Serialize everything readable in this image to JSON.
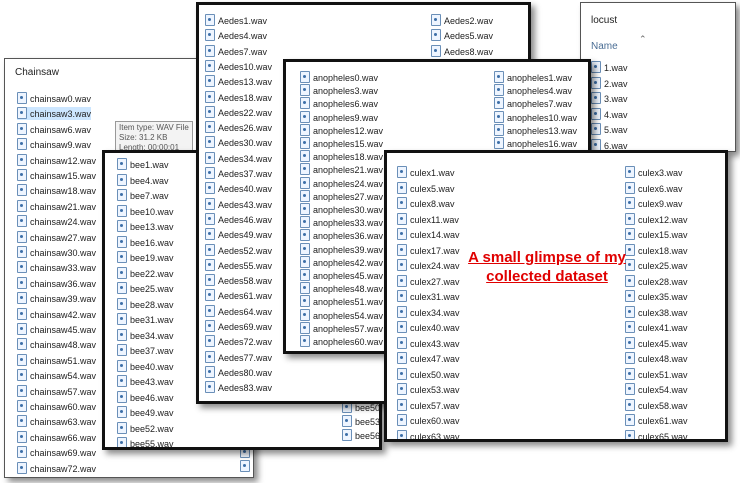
{
  "chainsaw": {
    "title": "Chainsaw",
    "files": [
      "chainsaw0.wav",
      "chainsaw3.wav",
      "chainsaw6.wav",
      "chainsaw9.wav",
      "chainsaw12.wav",
      "chainsaw15.wav",
      "chainsaw18.wav",
      "chainsaw21.wav",
      "chainsaw24.wav",
      "chainsaw27.wav",
      "chainsaw30.wav",
      "chainsaw33.wav",
      "chainsaw36.wav",
      "chainsaw39.wav",
      "chainsaw42.wav",
      "chainsaw45.wav",
      "chainsaw48.wav",
      "chainsaw51.wav",
      "chainsaw54.wav",
      "chainsaw57.wav",
      "chainsaw60.wav",
      "chainsaw63.wav",
      "chainsaw66.wav",
      "chainsaw69.wav",
      "chainsaw72.wav"
    ],
    "files_col2": [
      "chainsaw70.wav",
      "chainsaw73.wav"
    ],
    "tooltip": {
      "type": "Item type: WAV File",
      "size": "Size: 31.2 KB",
      "length": "Length: 00:00:01"
    }
  },
  "bee": {
    "files": [
      "bee1.wav",
      "bee4.wav",
      "bee7.wav",
      "bee10.wav",
      "bee13.wav",
      "bee16.wav",
      "bee19.wav",
      "bee22.wav",
      "bee25.wav",
      "bee28.wav",
      "bee31.wav",
      "bee34.wav",
      "bee37.wav",
      "bee40.wav",
      "bee43.wav",
      "bee46.wav",
      "bee49.wav",
      "bee52.wav",
      "bee55.wav"
    ],
    "files_col2": [
      "bee50.wav",
      "bee53.wav",
      "bee56.wav"
    ]
  },
  "aedes": {
    "col1": [
      "Aedes1.wav",
      "Aedes4.wav",
      "Aedes7.wav",
      "Aedes10.wav",
      "Aedes13.wav",
      "Aedes18.wav",
      "Aedes22.wav",
      "Aedes26.wav",
      "Aedes30.wav",
      "Aedes34.wav",
      "Aedes37.wav",
      "Aedes40.wav",
      "Aedes43.wav",
      "Aedes46.wav",
      "Aedes49.wav",
      "Aedes52.wav",
      "Aedes55.wav",
      "Aedes58.wav",
      "Aedes61.wav",
      "Aedes64.wav",
      "Aedes69.wav",
      "Aedes72.wav",
      "Aedes77.wav",
      "Aedes80.wav",
      "Aedes83.wav"
    ],
    "col2": [
      "Aedes2.wav",
      "Aedes5.wav",
      "Aedes8.wav"
    ]
  },
  "anopheles": {
    "col1": [
      "anopheles0.wav",
      "anopheles3.wav",
      "anopheles6.wav",
      "anopheles9.wav",
      "anopheles12.wav",
      "anopheles15.wav",
      "anopheles18.wav",
      "anopheles21.wav",
      "anopheles24.wav",
      "anopheles27.wav",
      "anopheles30.wav",
      "anopheles33.wav",
      "anopheles36.wav",
      "anopheles39.wav",
      "anopheles42.wav",
      "anopheles45.wav",
      "anopheles48.wav",
      "anopheles51.wav",
      "anopheles54.wav",
      "anopheles57.wav",
      "anopheles60.wav"
    ],
    "col2": [
      "anopheles1.wav",
      "anopheles4.wav",
      "anopheles7.wav",
      "anopheles10.wav",
      "anopheles13.wav",
      "anopheles16.wav"
    ]
  },
  "locust": {
    "title": "locust",
    "column_header": "Name",
    "files": [
      "1.wav",
      "2.wav",
      "3.wav",
      "4.wav",
      "5.wav",
      "6.wav"
    ]
  },
  "culex": {
    "col1": [
      "culex1.wav",
      "culex5.wav",
      "culex8.wav",
      "culex11.wav",
      "culex14.wav",
      "culex17.wav",
      "culex24.wav",
      "culex27.wav",
      "culex31.wav",
      "culex34.wav",
      "culex40.wav",
      "culex43.wav",
      "culex47.wav",
      "culex50.wav",
      "culex53.wav",
      "culex57.wav",
      "culex60.wav",
      "culex63.wav"
    ],
    "col2": [
      "culex3.wav",
      "culex6.wav",
      "culex9.wav",
      "culex12.wav",
      "culex15.wav",
      "culex18.wav",
      "culex25.wav",
      "culex28.wav",
      "culex35.wav",
      "culex38.wav",
      "culex41.wav",
      "culex45.wav",
      "culex48.wav",
      "culex51.wav",
      "culex54.wav",
      "culex58.wav",
      "culex61.wav",
      "culex65.wav"
    ]
  },
  "caption": {
    "line1": "A small glimpse of my",
    "line2": "collected dataset"
  },
  "colors": {
    "caption": "#e00000",
    "highlight": "#cce6ff",
    "border": "#111111"
  }
}
